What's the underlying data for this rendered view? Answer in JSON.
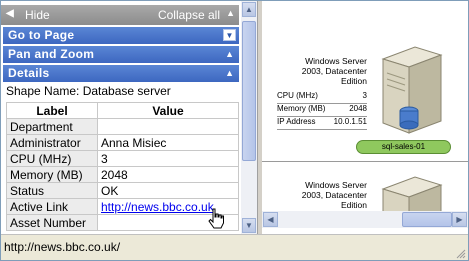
{
  "toolbar": {
    "hide_label": "Hide",
    "collapse_label": "Collapse all"
  },
  "sections": [
    {
      "title": "Go to Page"
    },
    {
      "title": "Pan and Zoom"
    },
    {
      "title": "Details"
    }
  ],
  "details": {
    "shape_name": "Shape Name: Database server",
    "headers": [
      "Label",
      "Value"
    ],
    "rows": [
      {
        "label": "Department",
        "value": ""
      },
      {
        "label": "Administrator",
        "value": "Anna Misiec"
      },
      {
        "label": "CPU (MHz)",
        "value": "3"
      },
      {
        "label": "Memory (MB)",
        "value": "2048"
      },
      {
        "label": "Status",
        "value": "OK"
      },
      {
        "label": "Active Link",
        "value": "http://news.bbc.co.uk"
      },
      {
        "label": "Asset Number",
        "value": ""
      }
    ]
  },
  "drawing": {
    "server1": {
      "title_line1": "Windows Server",
      "title_line2": "2003, Datacenter",
      "title_line3": "Edition",
      "props": [
        {
          "label": "CPU (MHz)",
          "value": "3"
        },
        {
          "label": "Memory (MB)",
          "value": "2048"
        },
        {
          "label": "IP Address",
          "value": "10.0.1.51"
        }
      ],
      "name": "sql-sales-01"
    },
    "server2": {
      "title_line1": "Windows Server",
      "title_line2": "2003, Datacenter",
      "title_line3": "Edition"
    }
  },
  "status": {
    "url": "http://news.bbc.co.uk/"
  },
  "colors": {
    "section_header": "#3d67c0",
    "toolbar": "#8c8c8c",
    "server_pill": "#8fc85e",
    "link": "#0000ee"
  }
}
